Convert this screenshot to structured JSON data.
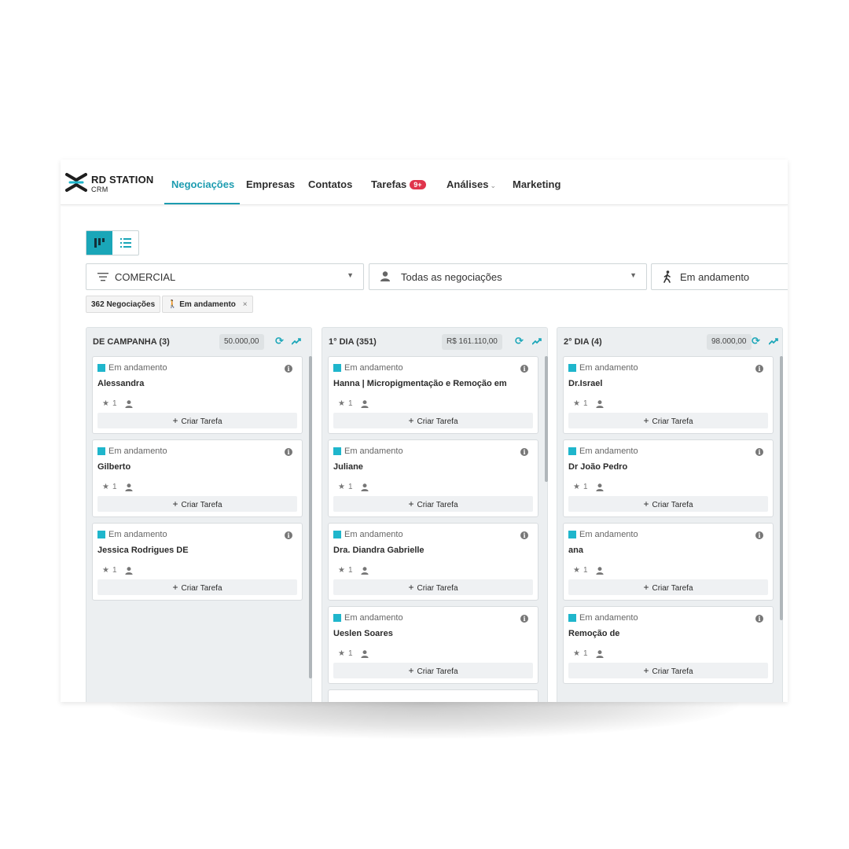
{
  "logo": {
    "main_bold": "RD",
    "main_rest": " STATION",
    "sub": "CRM"
  },
  "nav": {
    "items": [
      {
        "label": "Negociações"
      },
      {
        "label": "Empresas"
      },
      {
        "label": "Contatos"
      },
      {
        "label": "Tarefas",
        "badge": "9+"
      },
      {
        "label": "Análises"
      },
      {
        "label": "Marketing"
      }
    ]
  },
  "filters": {
    "pipeline": "COMERCIAL",
    "deals": "Todas as negociações",
    "status": "Em andamento"
  },
  "chips": {
    "count": "362 Negociações",
    "status": "Em andamento",
    "remove": "×"
  },
  "card_common": {
    "status": "Em andamento",
    "rating": "1",
    "task": "Criar Tarefa",
    "plus": "+"
  },
  "columns": [
    {
      "title": "DE CAMPANHA (3)",
      "value": "50.000,00",
      "cards": [
        "Alessandra",
        "Gilberto",
        "Jessica Rodrigues DE"
      ]
    },
    {
      "title": "1° DIA (351)",
      "value": "R$ 161.110,00",
      "cards": [
        "Hanna | Micropigmentação e Remoção em",
        "Juliane",
        "Dra. Diandra Gabrielle",
        "Ueslen Soares"
      ]
    },
    {
      "title": "2° DIA (4)",
      "value": "98.000,00",
      "cards": [
        "Dr.Israel",
        "Dr João Pedro",
        "ana",
        "Remoção de"
      ]
    }
  ],
  "colors": {
    "accent": "#1d9cb0",
    "status_square": "#1fb6cc",
    "badge": "#e0344c"
  }
}
